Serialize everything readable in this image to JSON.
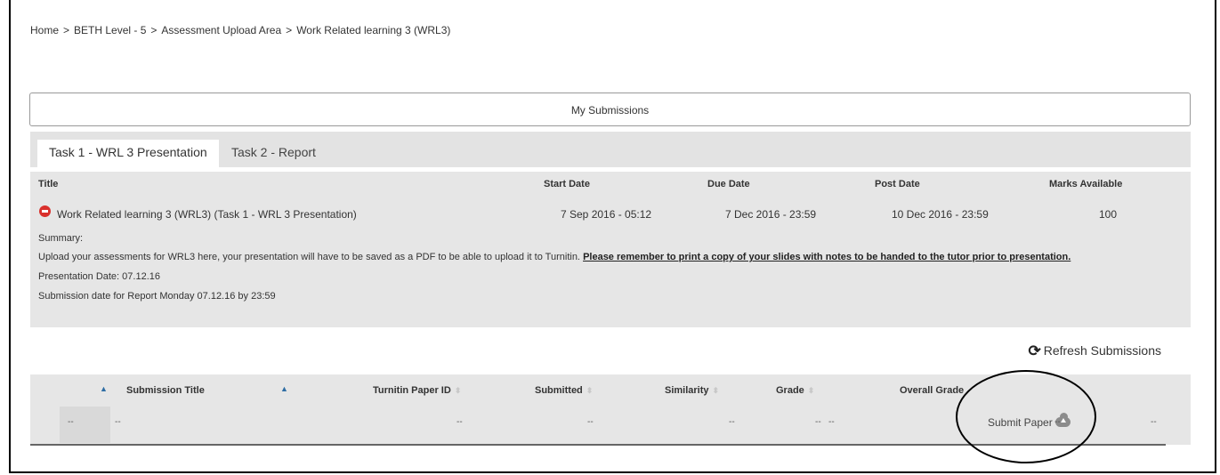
{
  "breadcrumb": {
    "items": [
      "Home",
      "BETH Level - 5",
      "Assessment Upload Area",
      "Work Related learning 3 (WRL3)"
    ],
    "separator": ">"
  },
  "submissions_header": "My Submissions",
  "tabs": [
    {
      "label": "Task 1 - WRL 3 Presentation",
      "active": true
    },
    {
      "label": "Task 2 - Report",
      "active": false
    }
  ],
  "task": {
    "headers": {
      "title": "Title",
      "start_date": "Start Date",
      "due_date": "Due Date",
      "post_date": "Post Date",
      "marks_available": "Marks Available"
    },
    "title": "Work Related learning 3 (WRL3) (Task 1 - WRL 3 Presentation)",
    "start_date": "7 Sep 2016 - 05:12",
    "due_date": "7 Dec 2016 - 23:59",
    "post_date": "10 Dec 2016 - 23:59",
    "marks_available": "100",
    "status_icon": "stop-icon",
    "summary": {
      "label": "Summary:",
      "line1_text": "Upload your assessments for WRL3 here, your presentation will have to be saved as a PDF to be able to upload it to Turnitin.",
      "line1_emphasis": "Please remember to print a copy of your slides with notes to be handed to the tutor prior to presentation.",
      "line2": "Presentation Date: 07.12.16",
      "line3": "Submission date for Report Monday 07.12.16 by 23:59"
    }
  },
  "refresh_button": "Refresh Submissions",
  "table": {
    "columns": [
      "Submission Title",
      "Turnitin Paper ID",
      "Submitted",
      "Similarity",
      "Grade",
      "Overall Grade"
    ],
    "row": {
      "first": "--",
      "title": "--",
      "paper_id": "--",
      "submitted": "--",
      "similarity": "--",
      "grade": "--",
      "grade2": "--",
      "submit_label": "Submit Paper",
      "after_submit": "--",
      "last": "--"
    }
  },
  "colors": {
    "panel_bg": "#e6e6e6",
    "tabs_bg": "#e3e3e3",
    "status_red": "#d9302c",
    "sort_blue": "#2e6da4"
  }
}
